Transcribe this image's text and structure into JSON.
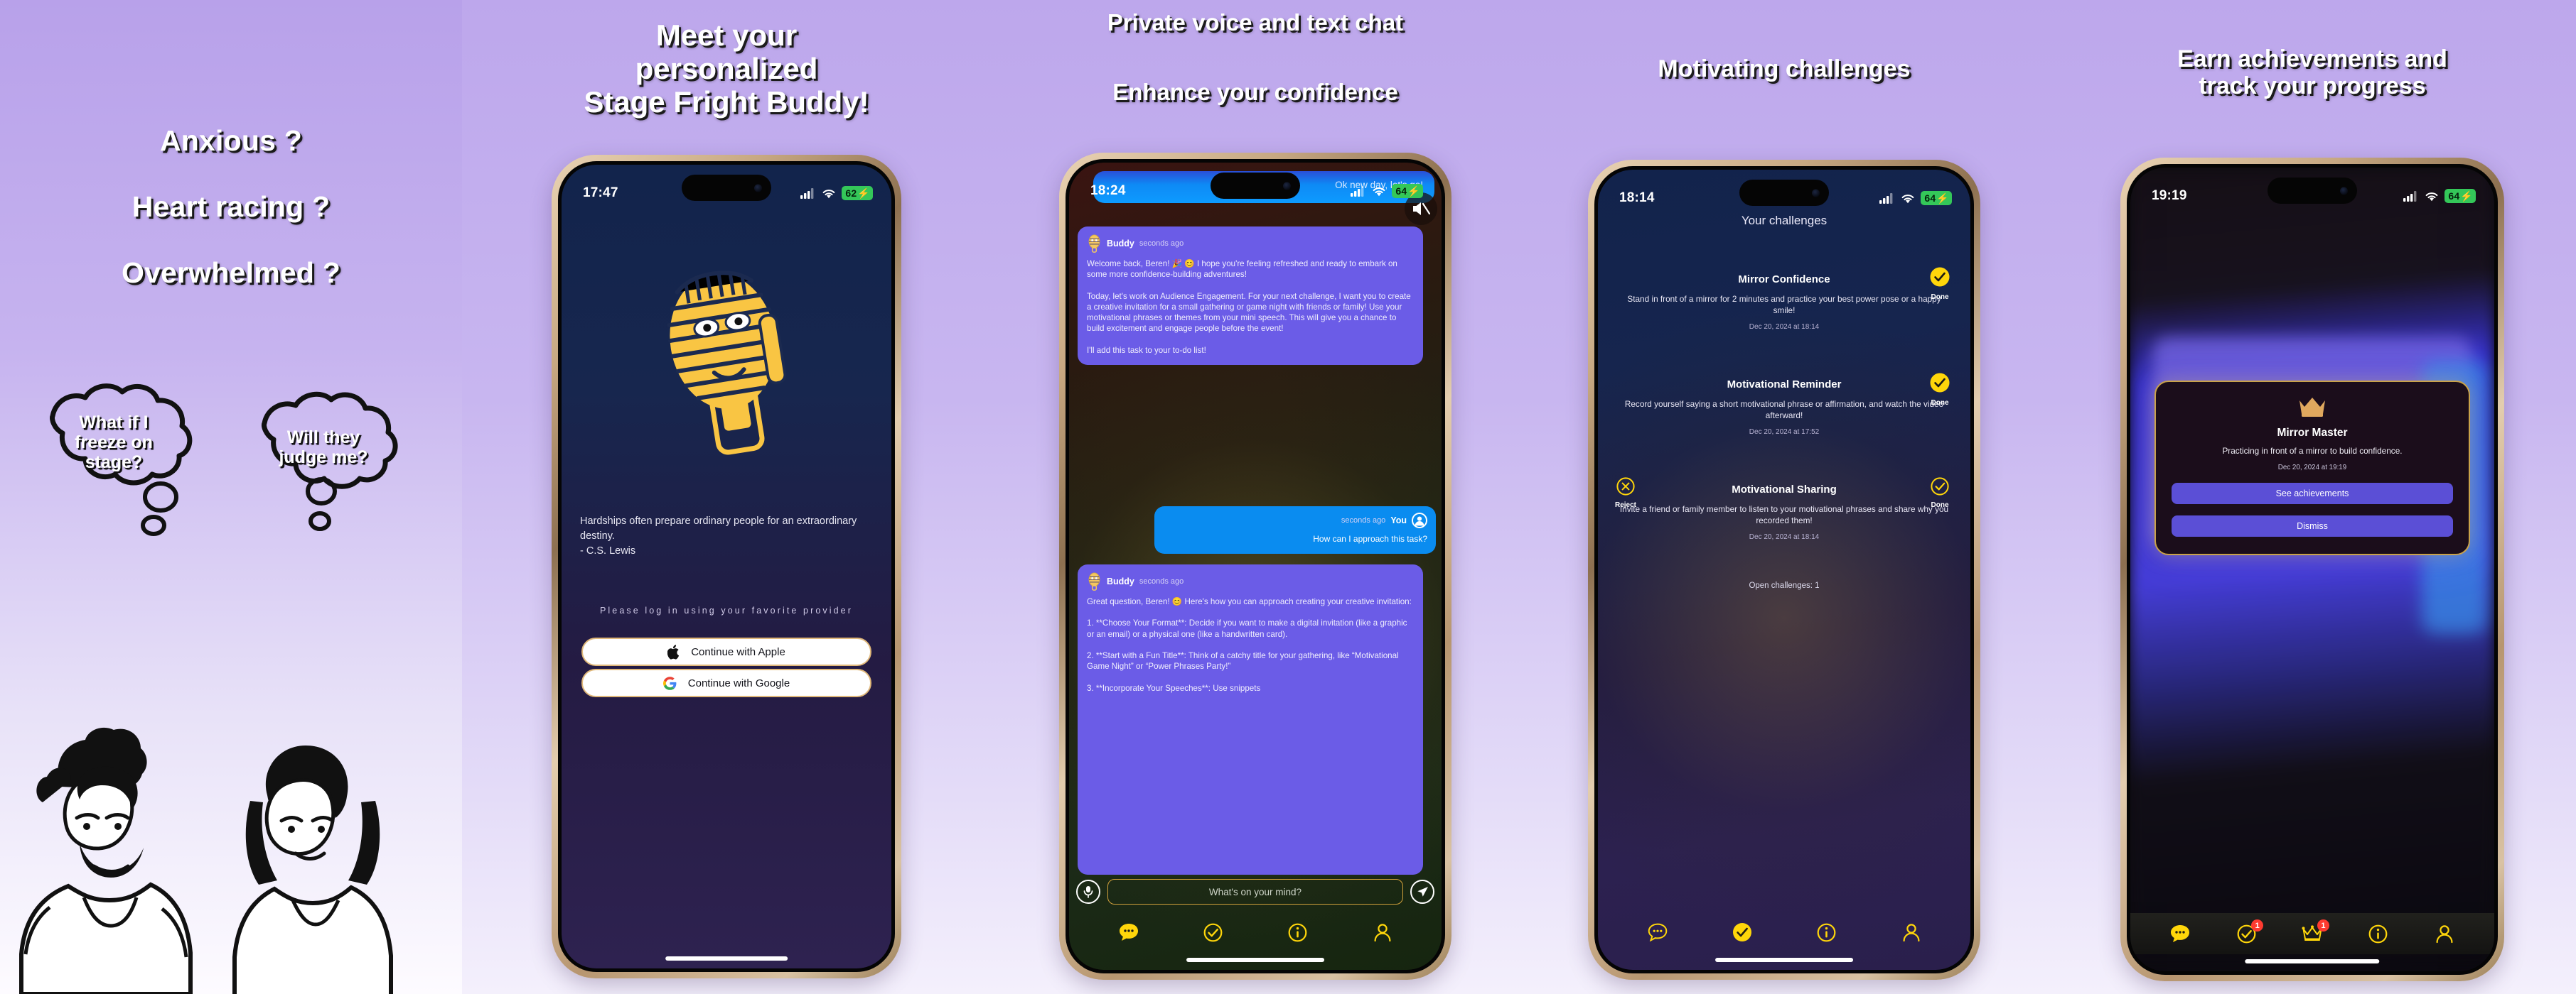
{
  "panel1": {
    "lines": [
      "Anxious ?",
      "Heart racing ?",
      "Overwhelmed ?"
    ],
    "thought_left": "What if I\nfreeze on\nstage?",
    "thought_right": "Will they\njudge me?"
  },
  "panel2": {
    "caption": "Meet your\npersonalized\nStage Fright Buddy!",
    "status": {
      "time": "17:47",
      "battery": "62"
    },
    "quote": "Hardships often prepare ordinary people for an extraordinary destiny.\n- C.S. Lewis",
    "login_hint": "Please log in using your favorite provider",
    "apple_button": "Continue with Apple",
    "google_button": "Continue with Google"
  },
  "panel3": {
    "caption_line1": "Private voice and text chat",
    "caption_line2": "Enhance your confidence",
    "status": {
      "time": "18:24",
      "battery": "64"
    },
    "top_bubble": "Ok new day, let's go!",
    "messages": [
      {
        "sender": "Buddy",
        "time": "seconds ago",
        "text": "Welcome back, Beren! 🎉 😊 I hope you're feeling refreshed and ready to embark on some more confidence-building adventures!\n\nToday, let's work on Audience Engagement. For your next challenge, I want you to create a creative invitation for a small gathering or game night with friends or family! Use your motivational phrases or themes from your mini speech. This will give you a chance to build excitement and engage people before the event!\n\nI'll add this task to your to-do list!"
      },
      {
        "sender": "You",
        "time": "seconds ago",
        "text": "How can I approach this task?"
      },
      {
        "sender": "Buddy",
        "time": "seconds ago",
        "text": "Great question, Beren! 😊 Here's how you can approach creating your creative invitation:\n\n1. **Choose Your Format**: Decide if you want to make a digital invitation (like a graphic or an email) or a physical one (like a handwritten card).\n\n2. **Start with a Fun Title**: Think of a catchy title for your gathering, like “Motivational Game Night” or “Power Phrases Party!”\n\n3. **Incorporate Your Speeches**: Use snippets"
      }
    ],
    "composer_placeholder": "What's on your mind?",
    "tabs": [
      "chat",
      "challenges",
      "info",
      "profile"
    ]
  },
  "panel4": {
    "caption": "Motivating challenges",
    "status": {
      "time": "18:14",
      "battery": "64"
    },
    "screen_title": "Your challenges",
    "challenges": [
      {
        "name": "Mirror Confidence",
        "desc": "Stand in front of a mirror for 2 minutes and practice your best power pose or a happy smile!",
        "date": "Dec 20, 2024 at 18:14",
        "done_label": "Done",
        "reject_label": ""
      },
      {
        "name": "Motivational Reminder",
        "desc": "Record yourself saying a short motivational phrase or affirmation, and watch the video afterward!",
        "date": "Dec 20, 2024 at 17:52",
        "done_label": "Done",
        "reject_label": ""
      },
      {
        "name": "Motivational Sharing",
        "desc": "Invite a friend or family member to listen to your motivational phrases and share why you recorded them!",
        "date": "Dec 20, 2024 at 18:14",
        "done_label": "Done",
        "reject_label": "Reject"
      }
    ],
    "open_challenges": "Open challenges: 1",
    "tabs": [
      "chat",
      "challenges",
      "info",
      "profile"
    ]
  },
  "panel5": {
    "caption": "Earn achievements and\ntrack your progress",
    "status": {
      "time": "19:19",
      "battery": "64"
    },
    "achievement": {
      "name": "Mirror Master",
      "desc": "Practicing in front of a mirror to build confidence.",
      "date": "Dec 20, 2024 at 19:19",
      "primary_button": "See achievements",
      "secondary_button": "Dismiss"
    },
    "tabs": [
      "chat",
      "challenges",
      "achievements",
      "info",
      "profile"
    ],
    "badges": {
      "challenges": "1",
      "achievements": "1"
    }
  },
  "colors": {
    "accent_yellow": "#FFD60A",
    "purple_bg": "#b49ae8",
    "bubble_purple": "#6b5ce7",
    "bubble_blue": "#0a8cf0",
    "badge_red": "#ff3b30",
    "gold_border": "#c9a24a"
  }
}
